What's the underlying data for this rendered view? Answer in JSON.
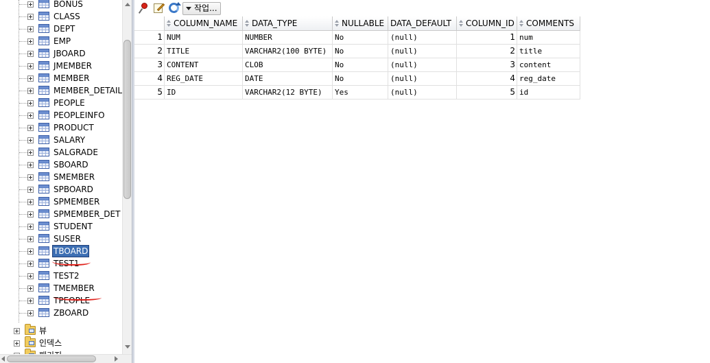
{
  "tree": {
    "tables": [
      {
        "label": "BONUS"
      },
      {
        "label": "CLASS"
      },
      {
        "label": "DEPT"
      },
      {
        "label": "EMP"
      },
      {
        "label": "JBOARD"
      },
      {
        "label": "JMEMBER"
      },
      {
        "label": "MEMBER"
      },
      {
        "label": "MEMBER_DETAIL"
      },
      {
        "label": "PEOPLE"
      },
      {
        "label": "PEOPLEINFO"
      },
      {
        "label": "PRODUCT"
      },
      {
        "label": "SALARY"
      },
      {
        "label": "SALGRADE"
      },
      {
        "label": "SBOARD"
      },
      {
        "label": "SMEMBER"
      },
      {
        "label": "SPBOARD"
      },
      {
        "label": "SPMEMBER"
      },
      {
        "label": "SPMEMBER_DET"
      },
      {
        "label": "STUDENT"
      },
      {
        "label": "SUSER"
      },
      {
        "label": "TBOARD",
        "selected": true
      },
      {
        "label": "TEST1"
      },
      {
        "label": "TEST2"
      },
      {
        "label": "TMEMBER"
      },
      {
        "label": "TPEOPLE"
      },
      {
        "label": "ZBOARD"
      }
    ],
    "categories": [
      {
        "label": "뷰"
      },
      {
        "label": "인덱스"
      },
      {
        "label": "패키지"
      }
    ]
  },
  "toolbar": {
    "pin_icon": "pin-icon",
    "edit_icon": "edit-icon",
    "refresh_icon": "refresh-icon",
    "action_label": "작업..."
  },
  "grid": {
    "columns": [
      "COLUMN_NAME",
      "DATA_TYPE",
      "NULLABLE",
      "DATA_DEFAULT",
      "COLUMN_ID",
      "COMMENTS"
    ],
    "rows": [
      [
        "1",
        "NUM",
        "NUMBER",
        "No",
        "(null)",
        "1",
        "num"
      ],
      [
        "2",
        "TITLE",
        "VARCHAR2(100 BYTE)",
        "No",
        "(null)",
        "2",
        "title"
      ],
      [
        "3",
        "CONTENT",
        "CLOB",
        "No",
        "(null)",
        "3",
        "content"
      ],
      [
        "4",
        "REG_DATE",
        "DATE",
        "No",
        "(null)",
        "4",
        "reg_date"
      ],
      [
        "5",
        "ID",
        "VARCHAR2(12 BYTE)",
        "Yes",
        "(null)",
        "5",
        "id"
      ]
    ]
  },
  "colors": {
    "selection": "#3d6fb3",
    "annotation_red": "#e0201a"
  }
}
